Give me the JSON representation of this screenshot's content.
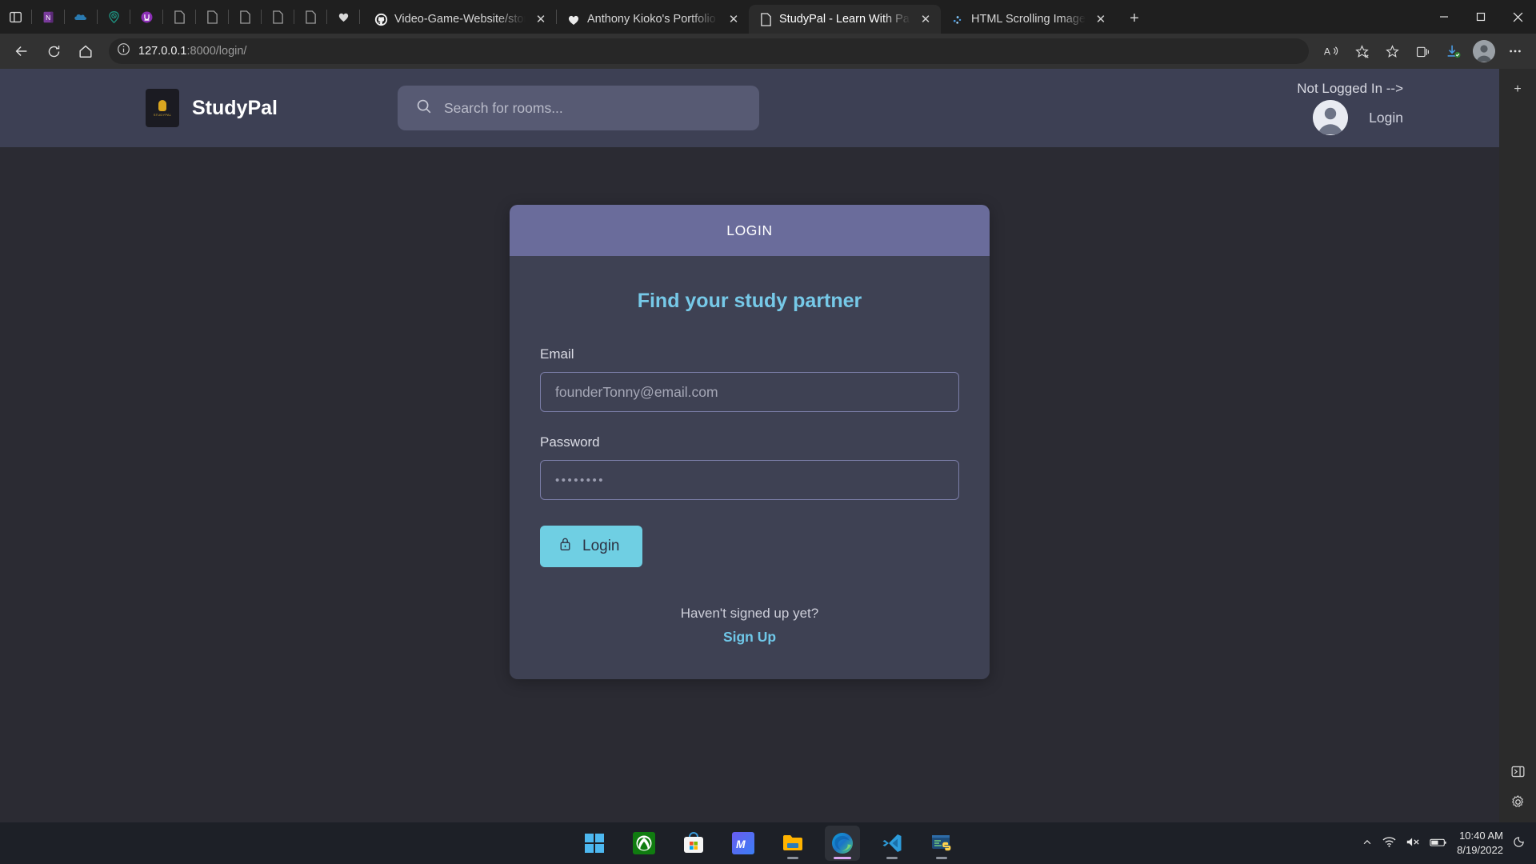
{
  "browser": {
    "quick_icons": [
      "sidebar-toggle-icon",
      "onenote-icon",
      "onedrive-icon",
      "teal-pin-icon",
      "purple-u-icon",
      "page-icon",
      "page-icon",
      "page-icon",
      "page-icon",
      "page-icon",
      "heart-icon"
    ],
    "tabs": [
      {
        "title": "Video-Game-Website/store a",
        "favicon": "github-icon",
        "active": false
      },
      {
        "title": "Anthony Kioko's Portfolio We",
        "favicon": "heart-icon",
        "active": false
      },
      {
        "title": "StudyPal - Learn With Pals Wo",
        "favicon": "page-icon",
        "active": true
      },
      {
        "title": "HTML Scrolling Image",
        "favicon": "dots-icon",
        "active": false
      }
    ],
    "new_tab_label": "+",
    "window_controls": {
      "minimize": "–",
      "maximize": "⬜",
      "close": "✕"
    },
    "nav": {
      "back": "back-arrow",
      "refresh": "refresh-arrow",
      "home": "home-icon",
      "url_host": "127.0.0.1",
      "url_path": ":8000/login/",
      "url_full": "127.0.0.1:8000/login/",
      "site_info": "info-icon",
      "read_aloud": "read-aloud-icon",
      "favorite": "add-favorite-icon",
      "favorites": "favorites-icon",
      "collections": "collections-icon",
      "downloads": "downloads-icon",
      "profile": "profile-avatar",
      "settings_more": "more-icon"
    },
    "rail": {
      "add": "+",
      "split": "split-screen-icon",
      "settings": "gear-icon"
    }
  },
  "site": {
    "brand": {
      "name": "StudyPal",
      "logo_caption": "STUDYPAL"
    },
    "search": {
      "placeholder": "Search for rooms...",
      "value": "",
      "icon": "search-icon"
    },
    "header_right": {
      "status": "Not Logged In -->",
      "login_label": "Login",
      "avatar": "default-user-avatar"
    }
  },
  "login_card": {
    "header": "LOGIN",
    "title": "Find your study partner",
    "email": {
      "label": "Email",
      "placeholder": "founderTonny@email.com",
      "value": ""
    },
    "password": {
      "label": "Password",
      "placeholder": "••••••••",
      "value": "••••••••"
    },
    "submit": {
      "label": "Login",
      "icon": "lock-icon"
    },
    "signup_question": "Haven't signed up yet?",
    "signup_link": "Sign Up"
  },
  "colors": {
    "page_bg": "#2b2b33",
    "header_bg": "#3d4054",
    "card_header": "#6a6c9b",
    "card_body": "#3e4153",
    "accent_cyan": "#6fcfe3",
    "title_blue": "#76c9e8",
    "input_border": "#7b7da8"
  },
  "taskbar": {
    "apps": [
      "windows-start-icon",
      "xbox-icon",
      "microsoft-store-icon",
      "merge-app-icon",
      "file-explorer-icon",
      "microsoft-edge-icon",
      "vscode-icon",
      "python-idle-icon"
    ],
    "tray": {
      "chevron": "show-hidden-icons-icon",
      "wifi": "wifi-icon",
      "volume": "volume-muted-icon",
      "battery": "battery-icon",
      "time": "10:40 AM",
      "date": "8/19/2022",
      "notifications": "notifications-icon"
    }
  }
}
